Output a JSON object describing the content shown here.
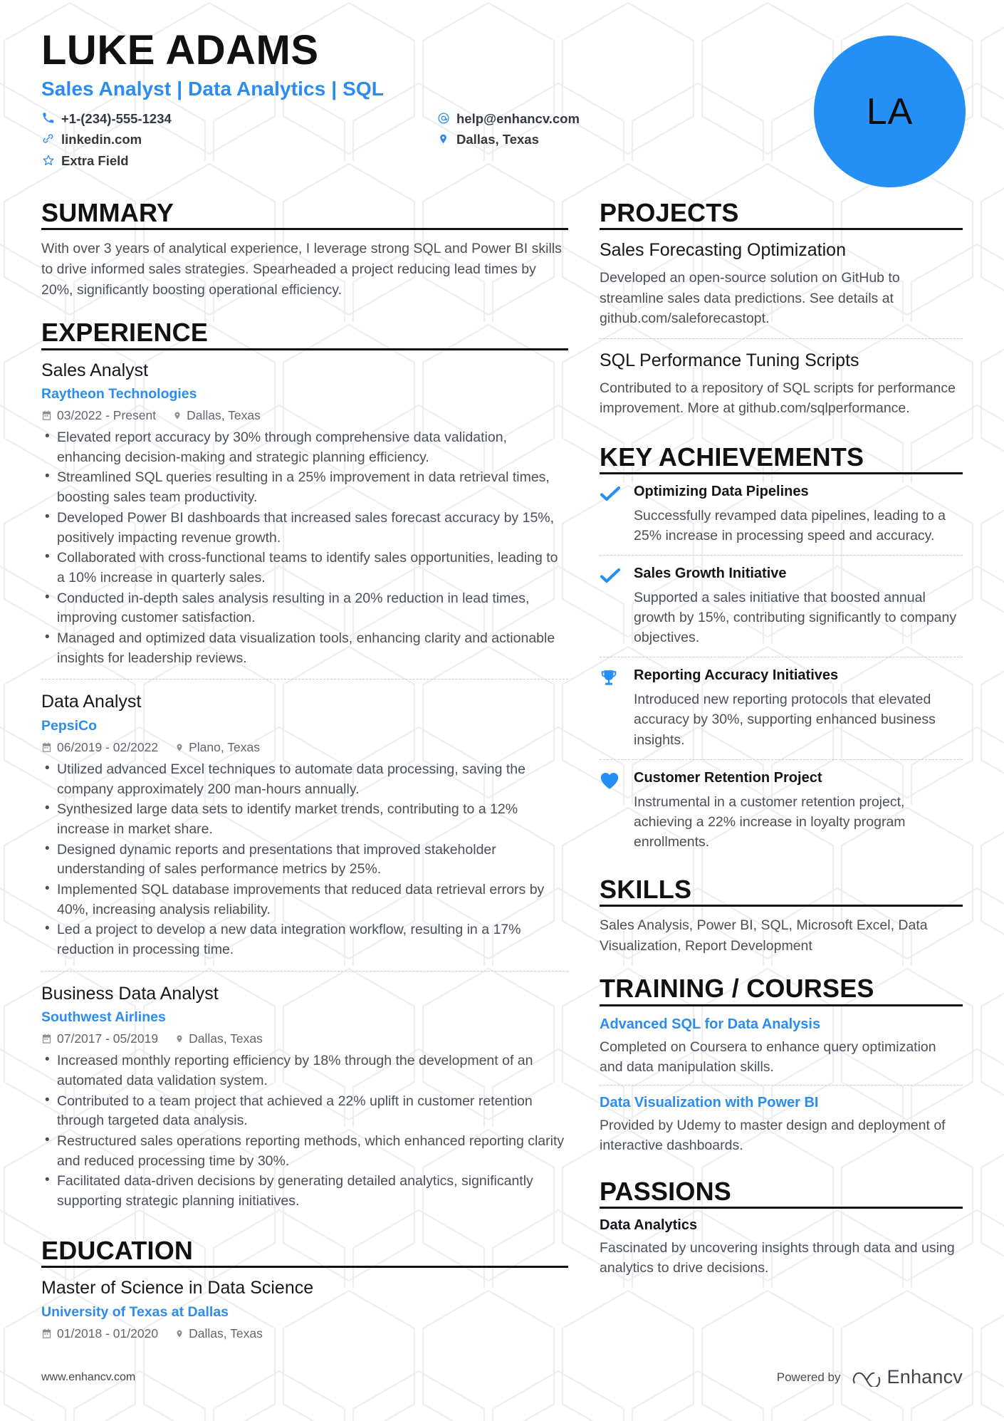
{
  "header": {
    "name": "LUKE ADAMS",
    "headline": "Sales Analyst | Data Analytics | SQL",
    "avatar_initials": "LA",
    "avatar_color": "#2490f5",
    "accent_color": "#2b8cf0",
    "contacts": [
      {
        "icon": "phone-icon",
        "value": "+1-(234)-555-1234"
      },
      {
        "icon": "email-icon",
        "value": "help@enhancv.com"
      },
      {
        "icon": "link-icon",
        "value": "linkedin.com"
      },
      {
        "icon": "location-pin-icon",
        "value": "Dallas, Texas"
      },
      {
        "icon": "star-icon",
        "value": "Extra Field"
      }
    ]
  },
  "summary": {
    "title": "SUMMARY",
    "text": "With over 3 years of analytical experience, I leverage strong SQL and Power BI skills to drive informed sales strategies. Spearheaded a project reducing lead times by 20%, significantly boosting operational efficiency."
  },
  "experience": {
    "title": "EXPERIENCE",
    "entries": [
      {
        "role": "Sales Analyst",
        "company": "Raytheon Technologies",
        "dates": "03/2022 - Present",
        "location": "Dallas, Texas",
        "bullets": [
          "Elevated report accuracy by 30% through comprehensive data validation, enhancing decision-making and strategic planning efficiency.",
          "Streamlined SQL queries resulting in a 25% improvement in data retrieval times, boosting sales team productivity.",
          "Developed Power BI dashboards that increased sales forecast accuracy by 15%, positively impacting revenue growth.",
          "Collaborated with cross-functional teams to identify sales opportunities, leading to a 10% increase in quarterly sales.",
          "Conducted in-depth sales analysis resulting in a 20% reduction in lead times, improving customer satisfaction.",
          "Managed and optimized data visualization tools, enhancing clarity and actionable insights for leadership reviews."
        ]
      },
      {
        "role": "Data Analyst",
        "company": "PepsiCo",
        "dates": "06/2019 - 02/2022",
        "location": "Plano, Texas",
        "bullets": [
          "Utilized advanced Excel techniques to automate data processing, saving the company approximately 200 man-hours annually.",
          "Synthesized large data sets to identify market trends, contributing to a 12% increase in market share.",
          "Designed dynamic reports and presentations that improved stakeholder understanding of sales performance metrics by 25%.",
          "Implemented SQL database improvements that reduced data retrieval errors by 40%, increasing analysis reliability.",
          "Led a project to develop a new data integration workflow, resulting in a 17% reduction in processing time."
        ]
      },
      {
        "role": "Business Data Analyst",
        "company": "Southwest Airlines",
        "dates": "07/2017 - 05/2019",
        "location": "Dallas, Texas",
        "bullets": [
          "Increased monthly reporting efficiency by 18% through the development of an automated data validation system.",
          "Contributed to a team project that achieved a 22% uplift in customer retention through targeted data analysis.",
          "Restructured sales operations reporting methods, which enhanced reporting clarity and reduced processing time by 30%.",
          "Facilitated data-driven decisions by generating detailed analytics, significantly supporting strategic planning initiatives."
        ]
      }
    ]
  },
  "education": {
    "title": "EDUCATION",
    "entries": [
      {
        "degree": "Master of Science in Data Science",
        "school": "University of Texas at Dallas",
        "dates": "01/2018 - 01/2020",
        "location": "Dallas, Texas"
      }
    ]
  },
  "projects": {
    "title": "PROJECTS",
    "entries": [
      {
        "name": "Sales Forecasting Optimization",
        "description": "Developed an open-source solution on GitHub to streamline sales data predictions. See details at github.com/saleforecastopt."
      },
      {
        "name": "SQL Performance Tuning Scripts",
        "description": "Contributed to a repository of SQL scripts for performance improvement. More at github.com/sqlperformance."
      }
    ]
  },
  "key_achievements": {
    "title": "KEY ACHIEVEMENTS",
    "entries": [
      {
        "icon": "check-icon",
        "name": "Optimizing Data Pipelines",
        "description": "Successfully revamped data pipelines, leading to a 25% increase in processing speed and accuracy."
      },
      {
        "icon": "check-icon",
        "name": "Sales Growth Initiative",
        "description": "Supported a sales initiative that boosted annual growth by 15%, contributing significantly to company objectives."
      },
      {
        "icon": "trophy-icon",
        "name": "Reporting Accuracy Initiatives",
        "description": "Introduced new reporting protocols that elevated accuracy by 30%, supporting enhanced business insights."
      },
      {
        "icon": "heart-icon",
        "name": "Customer Retention Project",
        "description": "Instrumental in a customer retention project, achieving a 22% increase in loyalty program enrollments."
      }
    ]
  },
  "skills": {
    "title": "SKILLS",
    "text": "Sales Analysis, Power BI, SQL, Microsoft Excel, Data Visualization, Report Development"
  },
  "training": {
    "title": "TRAINING / COURSES",
    "entries": [
      {
        "name": "Advanced SQL for Data Analysis",
        "description": "Completed on Coursera to enhance query optimization and data manipulation skills."
      },
      {
        "name": "Data Visualization with Power BI",
        "description": "Provided by Udemy to master design and deployment of interactive dashboards."
      }
    ]
  },
  "passions": {
    "title": "PASSIONS",
    "entries": [
      {
        "name": "Data Analytics",
        "description": "Fascinated by uncovering insights through data and using analytics to drive decisions."
      }
    ]
  },
  "footer": {
    "url": "www.enhancv.com",
    "powered_by": "Powered by",
    "brand": "Enhancv"
  }
}
